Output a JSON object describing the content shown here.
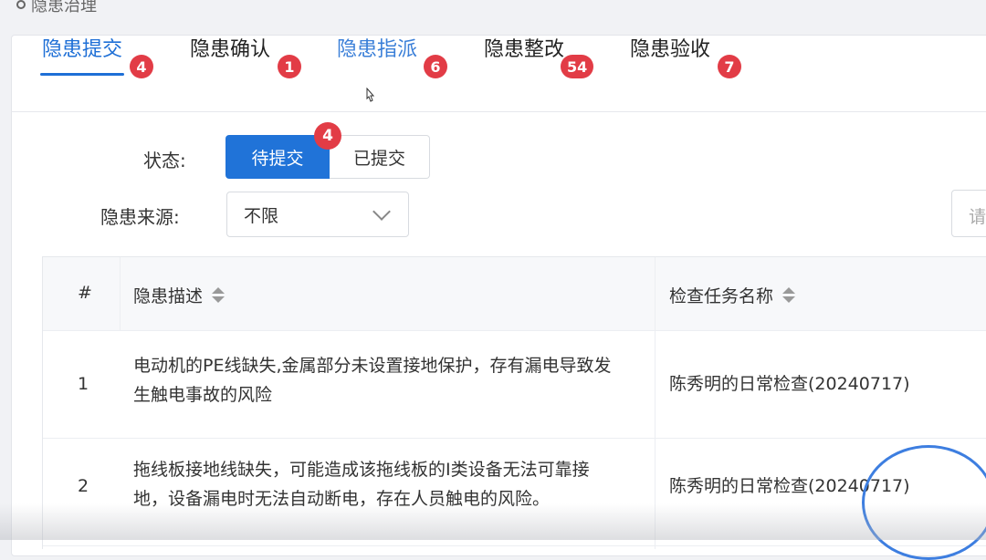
{
  "breadcrumb": "隐患治理",
  "tabs": [
    {
      "label": "隐患提交",
      "badge": "4"
    },
    {
      "label": "隐患确认",
      "badge": "1"
    },
    {
      "label": "隐患指派",
      "badge": "6"
    },
    {
      "label": "隐患整改",
      "badge": "54"
    },
    {
      "label": "隐患验收",
      "badge": "7"
    }
  ],
  "filters": {
    "status_label": "状态:",
    "status_pending": "待提交",
    "status_pending_badge": "4",
    "status_submitted": "已提交",
    "source_label": "隐患来源:",
    "source_value": "不限",
    "search_placeholder": "请"
  },
  "table": {
    "headers": {
      "index": "#",
      "description": "隐患描述",
      "task": "检查任务名称"
    },
    "rows": [
      {
        "index": "1",
        "description_line1": "电动机的PE线缺失,金属部分未设置接地保护，存有漏电导致发",
        "description_line2": "生触电事故的风险",
        "task": "陈秀明的日常检查(20240717)"
      },
      {
        "index": "2",
        "description_line1": "拖线板接地线缺失，可能造成该拖线板的I类设备无法可靠接",
        "description_line2": "地，设备漏电时无法自动断电，存在人员触电的风险。",
        "task": "陈秀明的日常检查(20240717)"
      }
    ]
  },
  "colors": {
    "accent": "#1e6fd6",
    "badge": "#e23c46"
  }
}
